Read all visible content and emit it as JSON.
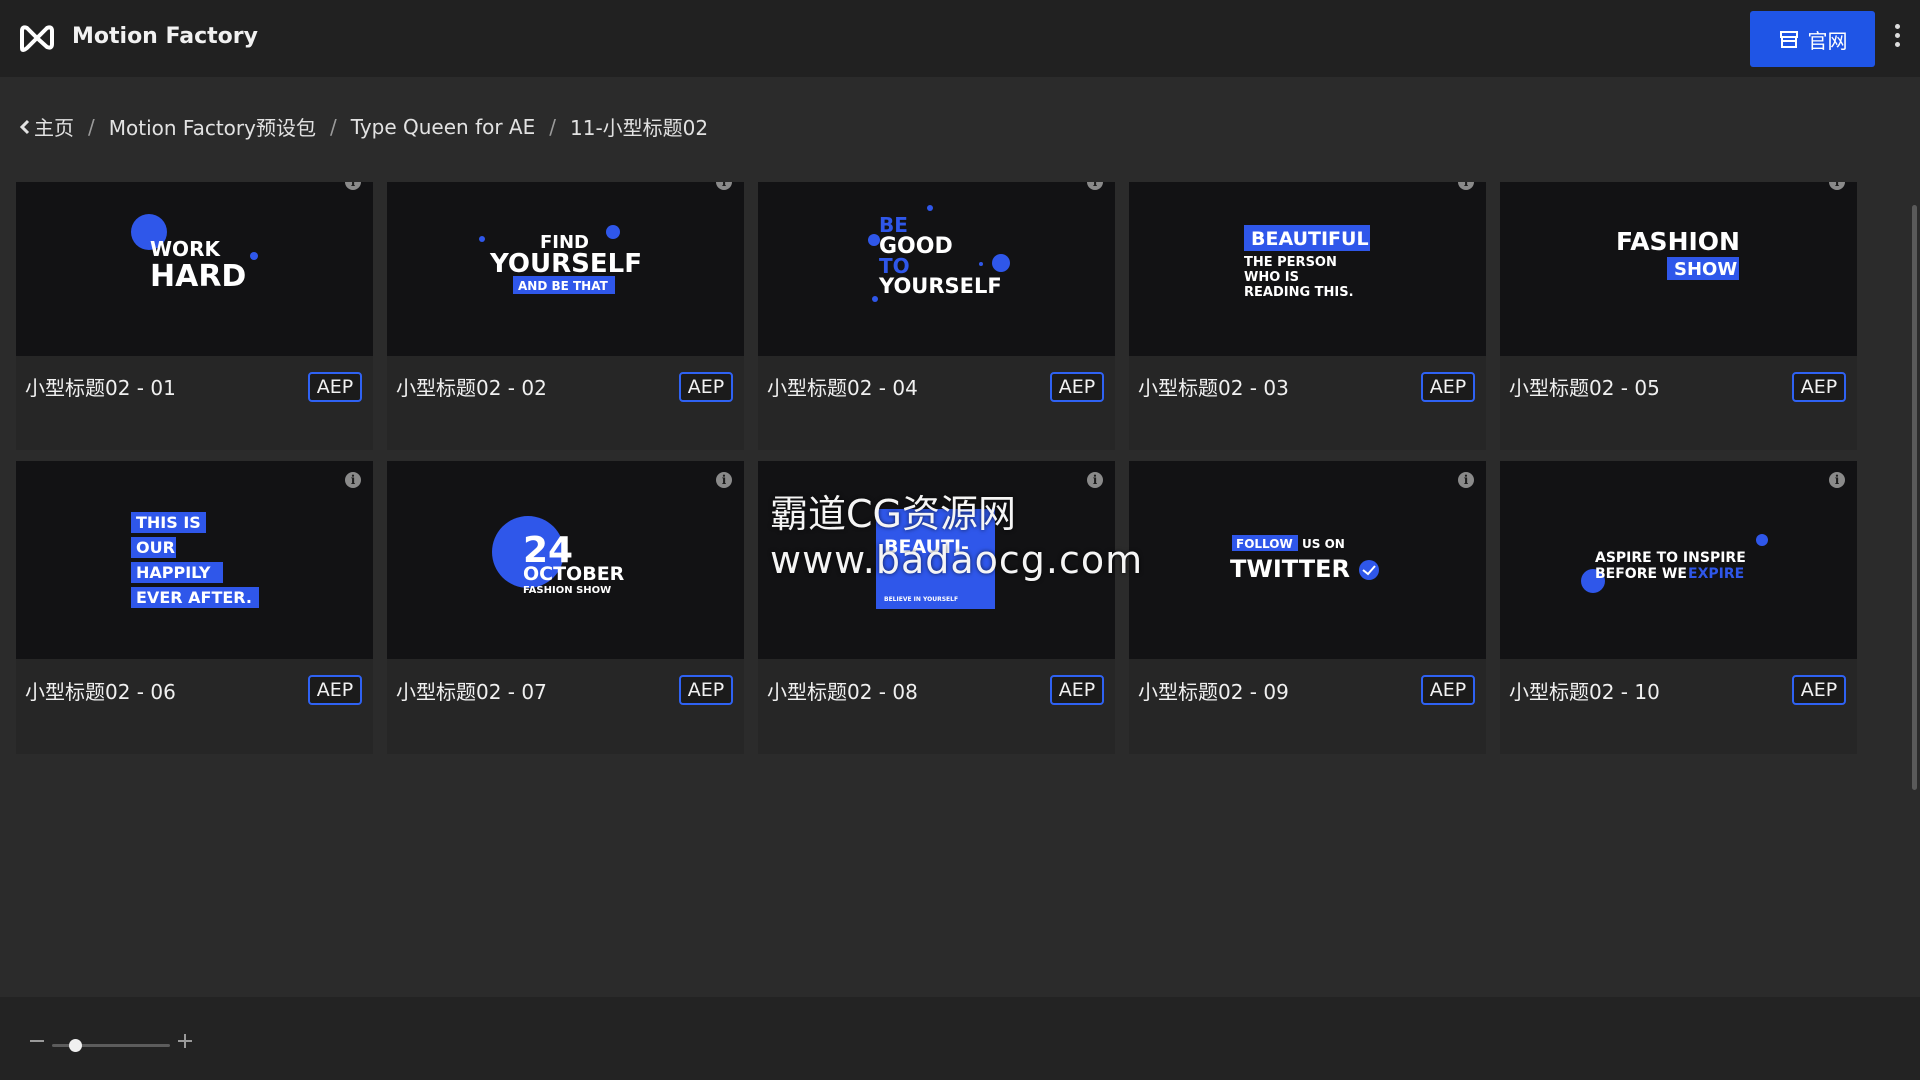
{
  "app": {
    "title": "Motion Factory",
    "site_button": "官网"
  },
  "breadcrumb": {
    "items": [
      "主页",
      "Motion Factory预设包",
      "Type Queen for AE",
      "11-小型标题02"
    ]
  },
  "cards": [
    {
      "title": "小型标题02 - 01",
      "badge": "AEP",
      "preview_lines": [
        "WORK",
        "HARD"
      ]
    },
    {
      "title": "小型标题02 - 02",
      "badge": "AEP",
      "preview_lines": [
        "FIND",
        "YOURSELF",
        "AND BE THAT"
      ]
    },
    {
      "title": "小型标题02 - 04",
      "badge": "AEP",
      "preview_lines": [
        "BE",
        "GOOD",
        "TO",
        "YOURSELF"
      ]
    },
    {
      "title": "小型标题02 - 03",
      "badge": "AEP",
      "preview_lines": [
        "BEAUTIFUL",
        "THE PERSON",
        "WHO IS",
        "READING THIS."
      ]
    },
    {
      "title": "小型标题02 - 05",
      "badge": "AEP",
      "preview_lines": [
        "FASHION",
        "SHOW"
      ]
    },
    {
      "title": "小型标题02 - 06",
      "badge": "AEP",
      "preview_lines": [
        "THIS IS",
        "OUR",
        "HAPPILY",
        "EVER AFTER."
      ]
    },
    {
      "title": "小型标题02 - 07",
      "badge": "AEP",
      "preview_lines": [
        "24",
        "OCTOBER",
        "FASHION SHOW"
      ]
    },
    {
      "title": "小型标题02 - 08",
      "badge": "AEP",
      "preview_lines": [
        "BEAUTI-",
        "BELIEVE IN YOURSELF"
      ]
    },
    {
      "title": "小型标题02 - 09",
      "badge": "AEP",
      "preview_lines": [
        "FOLLOW",
        "US ON",
        "TWITTER"
      ]
    },
    {
      "title": "小型标题02 - 10",
      "badge": "AEP",
      "preview_lines": [
        "ASPIRE TO INSPIRE",
        "BEFORE WE",
        "EXPIRE"
      ]
    }
  ],
  "watermark": {
    "line1": "霸道CG资源网",
    "line2": "www.badaocg.com"
  },
  "zoom": {
    "level": 0.2
  },
  "colors": {
    "accent": "#1f55e6",
    "background": "#2b2b2b",
    "topbar": "#212121"
  }
}
